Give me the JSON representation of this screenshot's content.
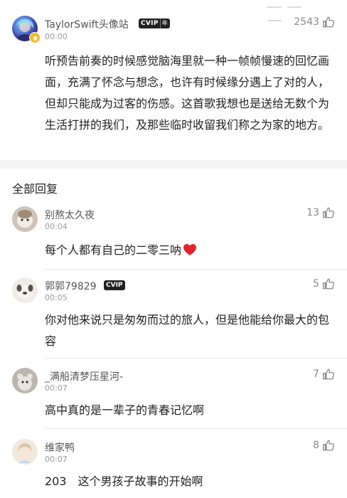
{
  "main_comment": {
    "username": "TaylorSwift头像站",
    "vip_label": "CVIP",
    "vip_year": "年",
    "time": "00:00",
    "likes": "2543",
    "text": "听预告前奏的时候感觉脑海里就一种一帧帧慢速的回忆画面，充满了怀念与想念，也许有时候缘分遇上了对的人，但却只能成为过客的伤感。这首歌我想也是送给无数个为生活打拼的我们，及那些临时收留我们称之为家的地方。"
  },
  "section_title": "全部回复",
  "replies": [
    {
      "username": "别熬太久夜",
      "time": "00:04",
      "likes": "13",
      "text": "每个人都有自己的二零三呐",
      "vip": ""
    },
    {
      "username": "郭郭79829",
      "time": "00:05",
      "likes": "5",
      "text": "你对他来说只是匆匆而过的旅人，但是他能给你最大的包容",
      "vip": "CVIP"
    },
    {
      "username": "_满船清梦压星河-",
      "time": "00:07",
      "likes": "7",
      "text": "高中真的是一辈子的青春记忆啊",
      "vip": ""
    },
    {
      "username": "维家鸭",
      "time": "00:07",
      "likes": "8",
      "text": "203　这个男孩子故事的开始啊",
      "vip": ""
    }
  ],
  "colors": {
    "heart": "#e0242f",
    "badge": "#222222",
    "separator": "#f3f3f3"
  }
}
